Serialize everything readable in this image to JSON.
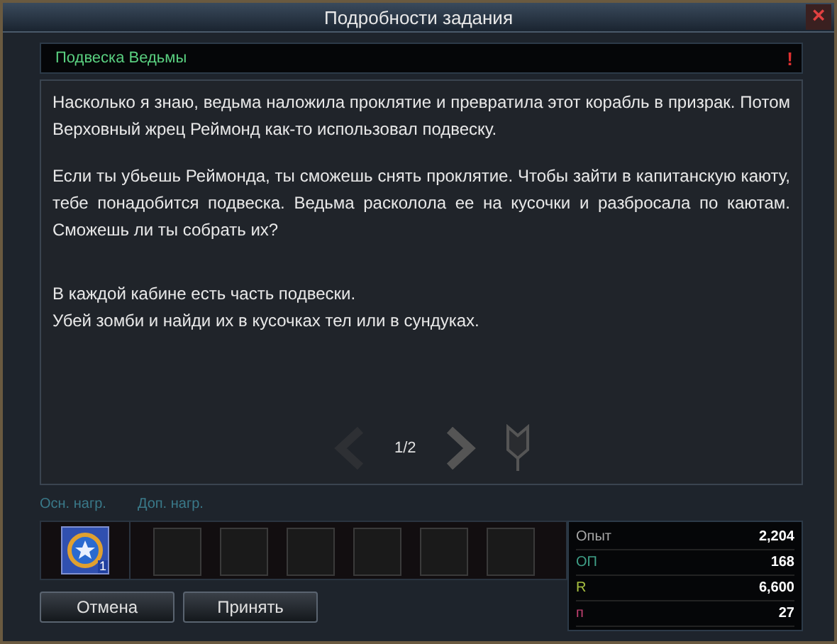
{
  "window": {
    "title": "Подробности задания",
    "close": "×"
  },
  "quest": {
    "name": "Подвеска Ведьмы",
    "mark": "!"
  },
  "paragraphs": [
    "Насколько я знаю, ведьма наложила проклятие и превратила этот корабль в призрак. Потом Верховный жрец Реймонд как-то использовал подвеску.",
    "Если ты убьешь Реймонда, ты сможешь снять проклятие. Чтобы зайти в капитанскую каюту, тебе понадобится подвеска. Ведьма расколола ее на кусочки и разбросала по каютам. Сможешь ли ты собрать их?",
    "В каждой кабине есть часть подвески.\nУбей зомби и найди их в кусочках тел или в сундуках."
  ],
  "pager": {
    "page": "1/2",
    "prev_disabled": true,
    "next_disabled": false
  },
  "rewards": {
    "main_label": "Осн. нагр.",
    "extra_label": "Доп. нагр.",
    "main": {
      "count": "1"
    },
    "extra_slots": [
      {
        "kind": "empty"
      },
      {
        "kind": "empty"
      },
      {
        "kind": "empty"
      },
      {
        "kind": "empty"
      },
      {
        "kind": "empty"
      },
      {
        "kind": "empty"
      }
    ]
  },
  "stats": [
    {
      "label": "Опыт",
      "value": "2,204",
      "color": "#a8a8a8"
    },
    {
      "label": "ОП",
      "value": "168",
      "color": "#3fa088"
    },
    {
      "label": "R",
      "value": "6,600",
      "color": "#a8c040"
    },
    {
      "label": "п",
      "value": "27",
      "color": "#c04070"
    }
  ],
  "buttons": [
    "Отмена",
    "Принять"
  ]
}
